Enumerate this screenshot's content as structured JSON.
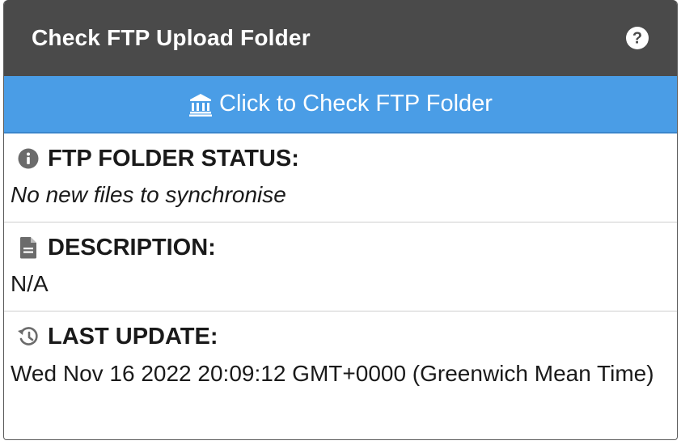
{
  "header": {
    "title": "Check FTP Upload Folder",
    "help_icon": "question-circle-icon"
  },
  "check_button": {
    "icon": "bank-icon",
    "label": "Click to Check FTP Folder"
  },
  "status": {
    "icon": "info-circle-icon",
    "heading": "FTP FOLDER STATUS:",
    "value": "No new files to synchronise"
  },
  "description": {
    "icon": "file-text-icon",
    "heading": "DESCRIPTION:",
    "value": "N/A"
  },
  "last_update": {
    "icon": "history-icon",
    "heading": "LAST UPDATE:",
    "value": "Wed Nov 16 2022 20:09:12 GMT+0000 (Greenwich Mean Time)"
  },
  "colors": {
    "header_bg": "#4a4a4a",
    "button_bg": "#4a9de6",
    "icon_grey": "#6b6b6b"
  }
}
